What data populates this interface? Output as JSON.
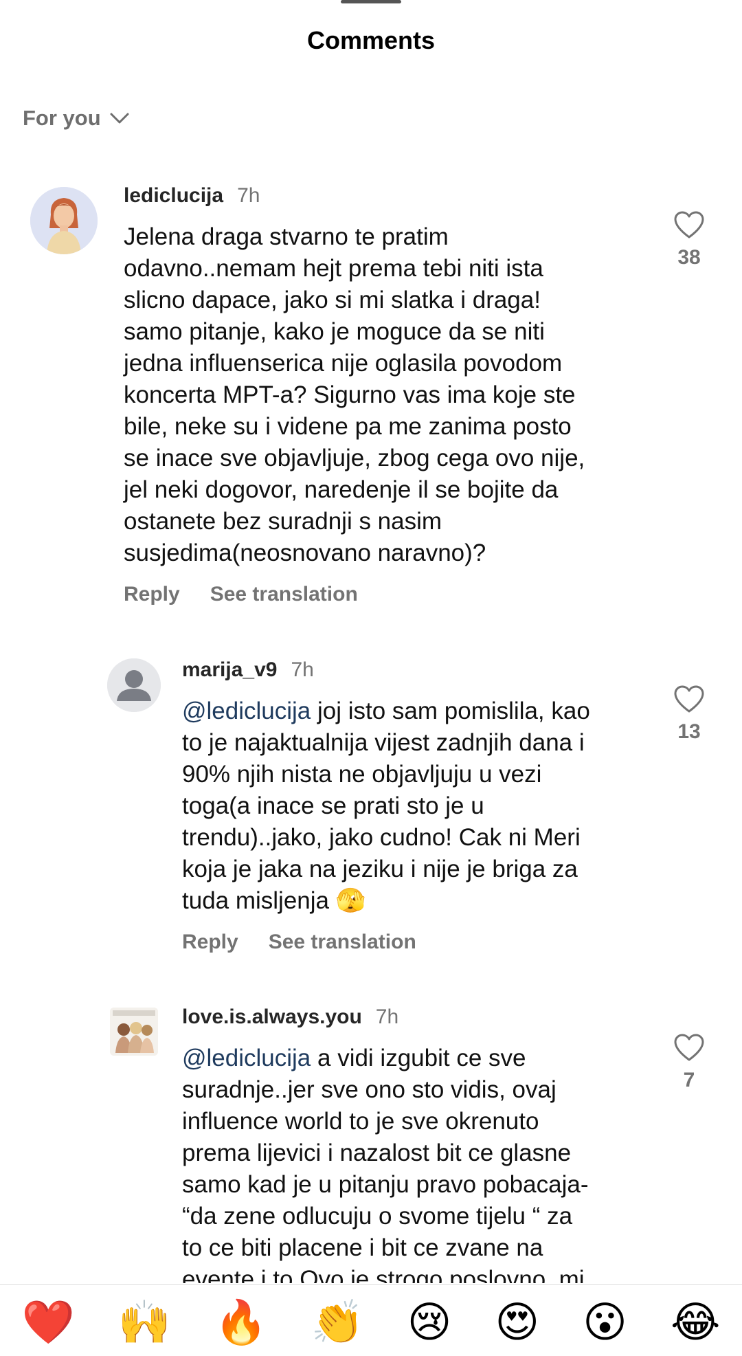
{
  "sheet": {
    "title": "Comments"
  },
  "filter": {
    "label": "For you"
  },
  "comments": [
    {
      "username": "lediclucija",
      "time": "7h",
      "mention": "",
      "text": "Jelena draga stvarno te pratim\nodavno..nemam hejt prema tebi niti ista\nslicno dapace, jako si mi slatka i draga!\nsamo pitanje, kako je moguce da se niti\njedna influenserica nije oglasila povodom\nkoncerta MPT-a? Sigurno vas ima koje ste\nbile, neke su i videne pa me zanima posto\nse inace sve objavljuje, zbog cega ovo nije,\njel neki dogovor, naredenje il se bojite da\nostanete bez suradnji s nasim\nsusjedima(neosnovano naravno)?",
      "reply_label": "Reply",
      "translate_label": "See translation",
      "likes": "38"
    },
    {
      "username": "marija_v9",
      "time": "7h",
      "mention": "@lediclucija",
      "text": " joj isto sam pomislila, kao\nto je najaktualnija vijest zadnjih dana i\n90% njih nista ne objavljuju u vezi\ntoga(a inace se prati sto je u\ntrendu)..jako, jako cudno! Cak ni Meri\nkoja je jaka na jeziku i nije je briga za\ntuda misljenja 🫣",
      "reply_label": "Reply",
      "translate_label": "See translation",
      "likes": "13"
    },
    {
      "username": "love.is.always.you",
      "time": "7h",
      "mention": "@lediclucija",
      "text": " a vidi izgubit ce sve\nsuradnje..jer sve ono sto vidis, ovaj\ninfluence world to je sve okrenuto\nprema lijevici i nazalost bit ce glasne\nsamo kad je u pitanju pravo pobacaja-\n“da zene odlucuju o svome tijelu “ za\nto ce biti placene i bit ce zvane na\nevente i to Ovo je strogo poslovno, mi",
      "likes": "7"
    }
  ],
  "emoji_bar": {
    "heart": "❤️",
    "raised_hands": "🙌",
    "fire": "🔥",
    "clapping": "👏",
    "crying": "😢",
    "heart_eyes": "😍",
    "surprised": "😮",
    "laughing": "😂"
  }
}
